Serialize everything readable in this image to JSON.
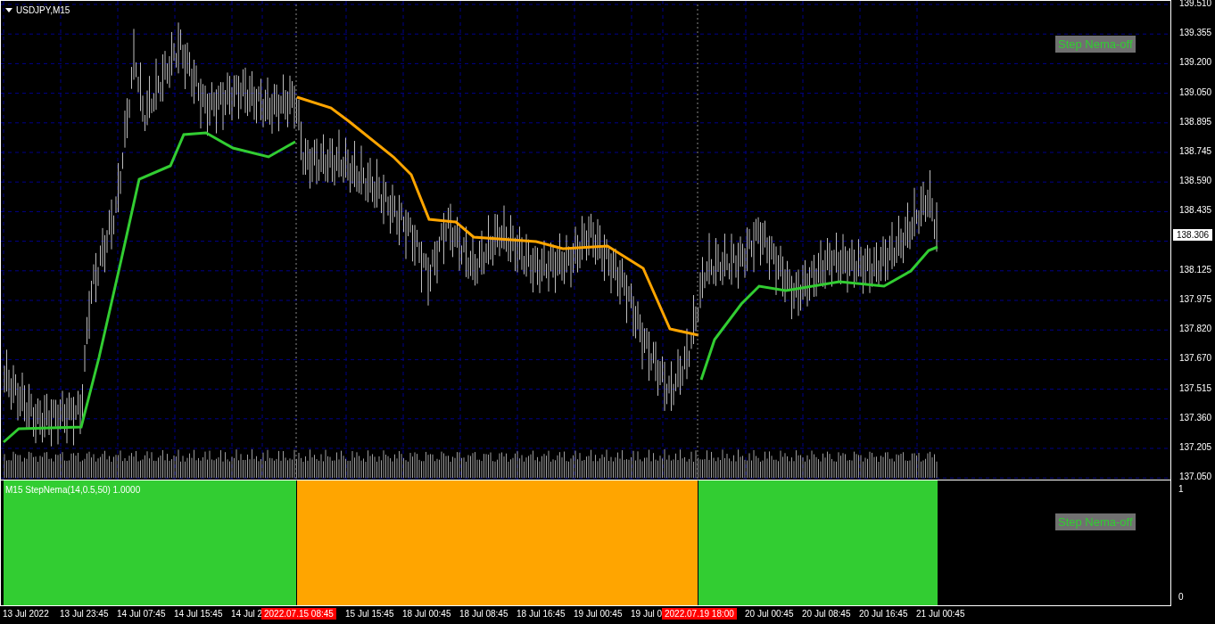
{
  "chart_window": {
    "title": "USDJPY,M15",
    "toggle_label": "Step Nema-off"
  },
  "price_axis": [
    "139.510",
    "139.355",
    "139.200",
    "139.050",
    "138.895",
    "138.745",
    "138.590",
    "138.435",
    "138.125",
    "137.975",
    "137.820",
    "137.670",
    "137.515",
    "137.360",
    "137.205",
    "137.050"
  ],
  "current_price": "138.306",
  "indicator": {
    "label": "M15 StepNema(14,0.5,50) 1.0000",
    "toggle_label": "Step Nema-off",
    "axis": [
      "1",
      "0"
    ],
    "segments": [
      {
        "color": "#32cd32"
      },
      {
        "color": "#ffa500"
      },
      {
        "color": "#32cd32"
      }
    ]
  },
  "time_axis": [
    {
      "kind": "tick",
      "text": "13 Jul 2022"
    },
    {
      "kind": "tick",
      "text": "13 Jul 23:45"
    },
    {
      "kind": "tick",
      "text": "14 Jul 07:45"
    },
    {
      "kind": "tick",
      "text": "14 Jul 15:45"
    },
    {
      "kind": "tick",
      "text": "14 Jul 2"
    },
    {
      "kind": "cursor",
      "text": "2022.07.15 08:45"
    },
    {
      "kind": "tick",
      "text": "15 Jul 15:45"
    },
    {
      "kind": "tick",
      "text": "18 Jul 00:45"
    },
    {
      "kind": "tick",
      "text": "18 Jul 08:45"
    },
    {
      "kind": "tick",
      "text": "18 Jul 16:45"
    },
    {
      "kind": "tick",
      "text": "19 Jul 00:45"
    },
    {
      "kind": "tick",
      "text": "19 Jul 0"
    },
    {
      "kind": "cursor",
      "text": "2022.07.19 18:00"
    },
    {
      "kind": "tick",
      "text": "20 Jul 00:45"
    },
    {
      "kind": "tick",
      "text": "20 Jul 08:45"
    },
    {
      "kind": "tick",
      "text": "20 Jul 16:45"
    },
    {
      "kind": "tick",
      "text": "21 Jul 00:45"
    }
  ]
}
